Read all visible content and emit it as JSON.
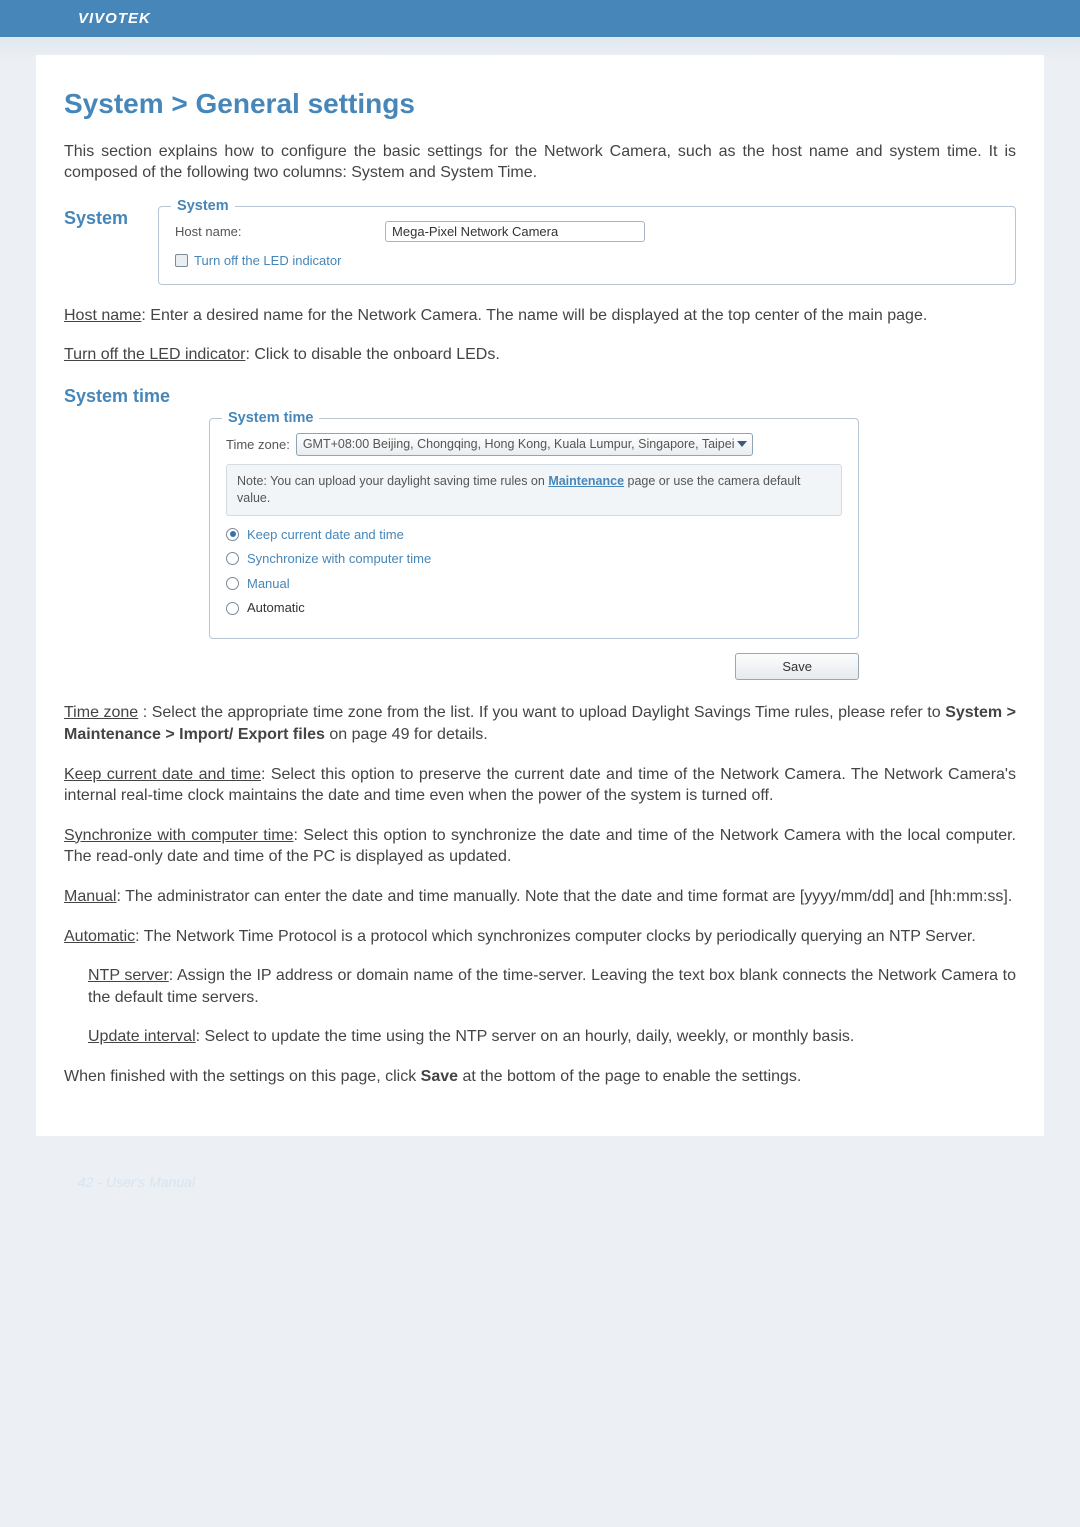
{
  "header": {
    "brand": "VIVOTEK"
  },
  "title": "System > General settings",
  "intro": "This section explains how to configure the basic settings for the Network Camera, such as the host name and system time. It is composed of the following two columns: System and System Time.",
  "system_section": {
    "side_label": "System",
    "legend": "System",
    "host_label": "Host name:",
    "host_value": "Mega-Pixel Network Camera",
    "led_label": "Turn off the LED indicator"
  },
  "body": {
    "hostname_desc_lead": "Host name",
    "hostname_desc": ": Enter a desired name for the Network Camera. The name will be displayed at the top center of the main page.",
    "led_lead": "Turn off the LED indicator",
    "led_desc": ": Click to disable the onboard LEDs."
  },
  "systime_section": {
    "side_label": "System time",
    "legend": "System time",
    "tz_label": "Time zone:",
    "tz_value": "GMT+08:00 Beijing, Chongqing, Hong Kong, Kuala Lumpur, Singapore, Taipei",
    "note_pre": "Note: You can upload your daylight saving time rules on ",
    "note_link": "Maintenance",
    "note_post": " page or use the camera default value.",
    "opt_keep": "Keep current date and time",
    "opt_sync": "Synchronize with computer time",
    "opt_manual": "Manual",
    "opt_auto": "Automatic",
    "save": "Save"
  },
  "descriptions": {
    "tz_lead": "Time zone",
    "tz_text": " : Select the appropriate time zone from the list. If you want to upload Daylight Savings Time rules, please refer to ",
    "tz_bold": "System > Maintenance > Import/ Export files",
    "tz_tail": " on page 49 for details.",
    "keep_lead": "Keep current date and time",
    "keep_text": ": Select this option to preserve the current date and time of the Network Camera. The Network Camera's internal real-time clock maintains the date and time even when the power of the system is turned off.",
    "sync_lead": "Synchronize with computer time",
    "sync_text": ": Select this option to synchronize the date and time of the Network Camera with the local computer. The read-only date and time of the PC is displayed as updated.",
    "manual_lead": "Manual",
    "manual_text": ": The administrator can enter the date and time manually. Note that the date and time format are [yyyy/mm/dd] and [hh:mm:ss].",
    "auto_lead": "Automatic",
    "auto_text": ": The Network Time Protocol is a protocol which synchronizes computer clocks by periodically querying an NTP Server.",
    "ntp_lead": "NTP server",
    "ntp_text": ": Assign the IP address or domain name of the time-server. Leaving the text box blank connects the Network Camera to the default time servers.",
    "upd_lead": "Update interval",
    "upd_text": ": Select to update the time using the NTP server on an hourly, daily, weekly, or monthly basis.",
    "final_pre": "When finished with the settings on this page, click ",
    "final_bold": "Save",
    "final_post": " at the bottom of the page to enable the settings."
  },
  "footer": {
    "pagenum": "42 - User's Manual"
  }
}
